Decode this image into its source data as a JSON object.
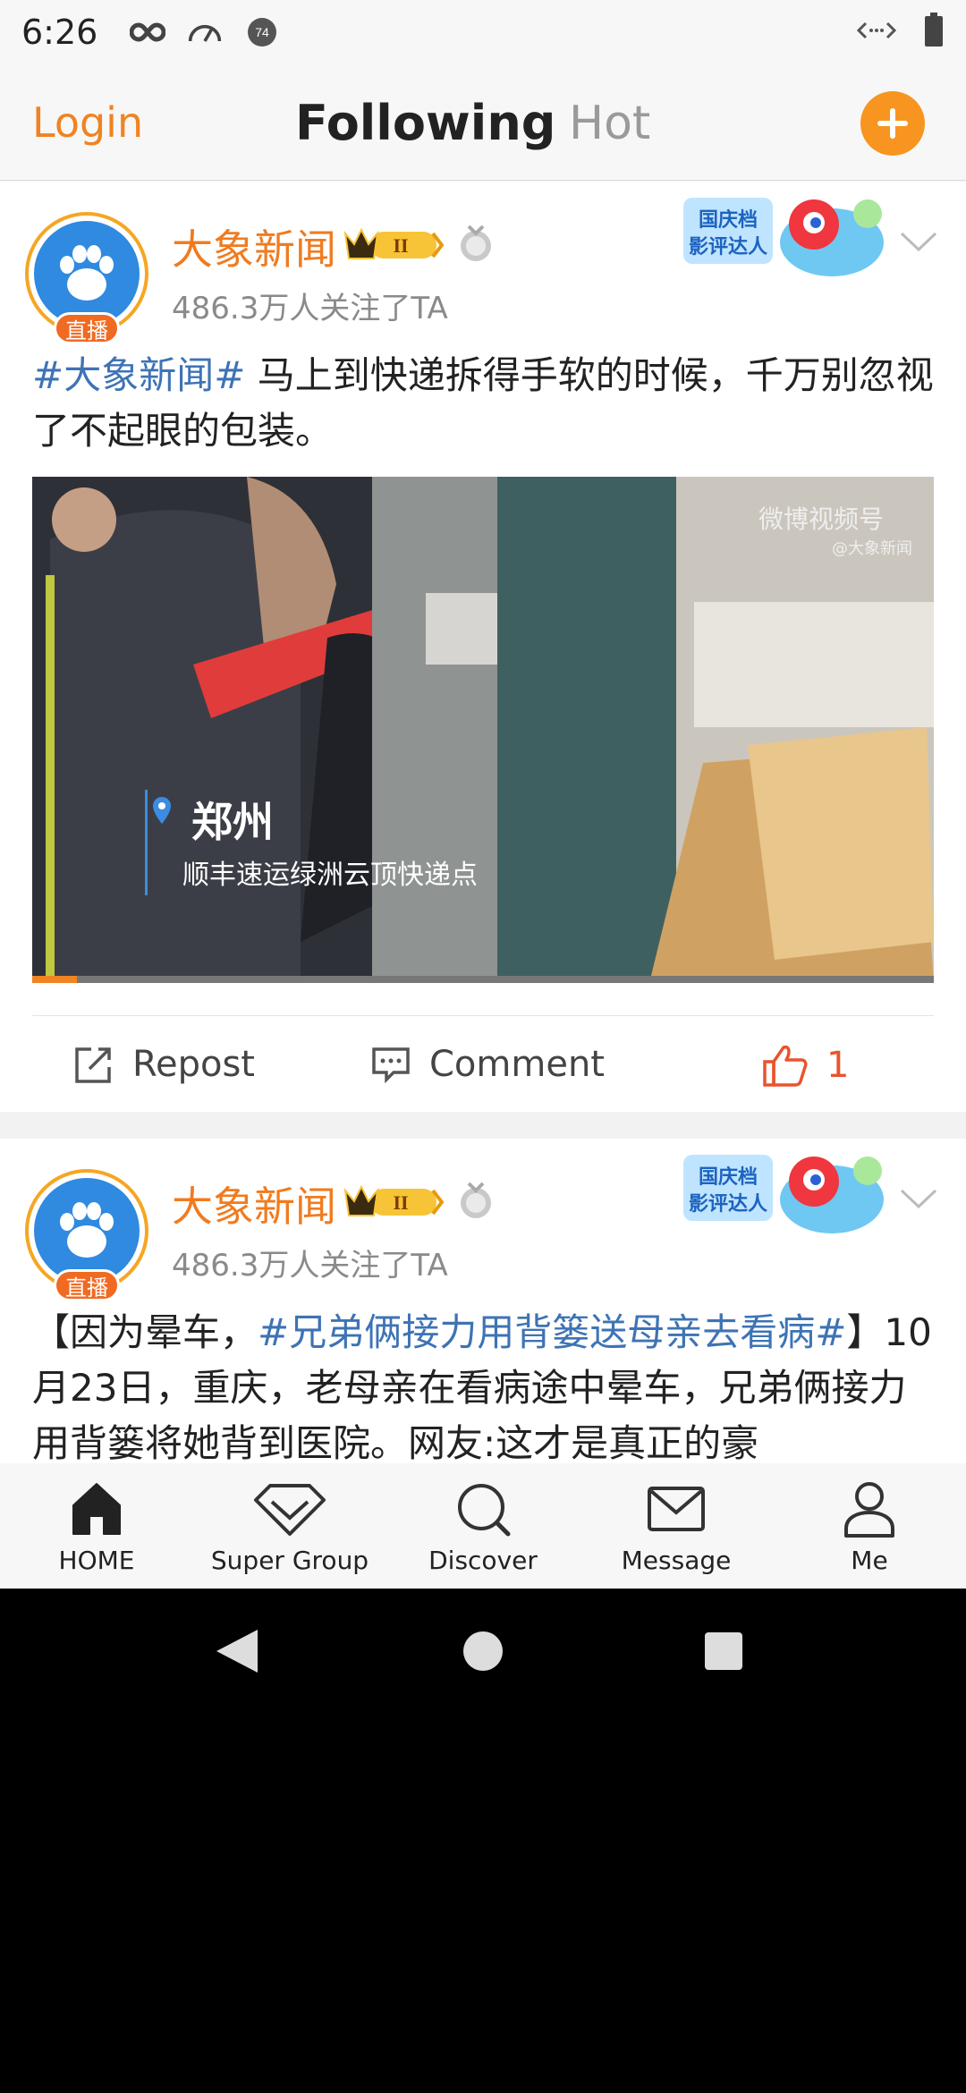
{
  "status_bar": {
    "time": "6:26",
    "notification_number": "74",
    "icons": [
      "infinity-icon",
      "speedometer-icon",
      "badge-icon",
      "data-transfer-icon",
      "battery-icon"
    ]
  },
  "top_nav": {
    "login": "Login",
    "tabs": [
      {
        "label": "Following",
        "active": true
      },
      {
        "label": "Hot",
        "active": false
      }
    ],
    "accent_color": "#f79520"
  },
  "posts": [
    {
      "username": "大象新闻",
      "live_badge": "直播",
      "level_badge": "II",
      "followers": "486.3万人关注了TA",
      "promo_text": "国庆档影评达人",
      "hashtag": "#大象新闻#",
      "text": " 马上到快递拆得手软的时候，千万别忽视了不起眼的包装。",
      "video": {
        "location_city": "郑州",
        "location_place": "顺丰速运绿洲云顶快递点",
        "watermark_title": "微博视频号",
        "watermark_sub": "@大象新闻",
        "progress": 0.05
      },
      "actions": {
        "repost": "Repost",
        "comment": "Comment",
        "like_count": "1"
      }
    },
    {
      "username": "大象新闻",
      "live_badge": "直播",
      "level_badge": "II",
      "followers": "486.3万人关注了TA",
      "promo_text": "国庆档影评达人",
      "text_prefix": "【因为晕车，",
      "hashtag": "#兄弟俩接力用背篓送母亲去看病#",
      "text_suffix": "】10月23日，重庆，老母亲在看病途中晕车，兄弟俩接力用背篓将她背到医院。网友:这才是真正的豪"
    }
  ],
  "tab_bar": [
    {
      "label": "HOME",
      "icon": "home-icon"
    },
    {
      "label": "Super Group",
      "icon": "diamond-icon"
    },
    {
      "label": "Discover",
      "icon": "search-icon"
    },
    {
      "label": "Message",
      "icon": "envelope-icon"
    },
    {
      "label": "Me",
      "icon": "person-icon"
    }
  ]
}
